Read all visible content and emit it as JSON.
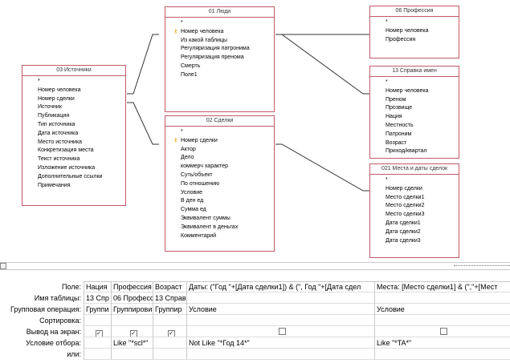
{
  "tables": [
    {
      "id": "t01",
      "title": "01 Люди",
      "fields": [
        {
          "label": "*"
        },
        {
          "label": "Номер человека",
          "key": true
        },
        {
          "label": "Из какой таблицы"
        },
        {
          "label": "Регуляризация патронима"
        },
        {
          "label": "Регуляризация пренома"
        },
        {
          "label": "Смерть"
        },
        {
          "label": "Поле1"
        }
      ]
    },
    {
      "id": "t03",
      "title": "03 Источники",
      "fields": [
        {
          "label": "*"
        },
        {
          "label": "Номер человека"
        },
        {
          "label": "Номер сделки"
        },
        {
          "label": "Источник"
        },
        {
          "label": "Публикация"
        },
        {
          "label": "Тип источника"
        },
        {
          "label": "Дата источника"
        },
        {
          "label": "Место источника"
        },
        {
          "label": "Конкретизация места"
        },
        {
          "label": "Текст источника"
        },
        {
          "label": "Изложение источника"
        },
        {
          "label": "Дополнительные ссылки"
        },
        {
          "label": "Примечания"
        }
      ]
    },
    {
      "id": "t02",
      "title": "02 Сделки",
      "fields": [
        {
          "label": "*"
        },
        {
          "label": "Номер сделки",
          "key": true
        },
        {
          "label": "Актор"
        },
        {
          "label": "Дело"
        },
        {
          "label": "коммерч характер"
        },
        {
          "label": "Суть/объект"
        },
        {
          "label": "По отношению"
        },
        {
          "label": "Условие"
        },
        {
          "label": "В ден ед"
        },
        {
          "label": "Сумма ед"
        },
        {
          "label": "Эквивалент суммы"
        },
        {
          "label": "Эквивалент в деньгах"
        },
        {
          "label": "Комментарий"
        }
      ]
    },
    {
      "id": "t06",
      "title": "06 Профессия",
      "fields": [
        {
          "label": "*"
        },
        {
          "label": "Номер человека"
        },
        {
          "label": "Профессия"
        }
      ]
    },
    {
      "id": "t13",
      "title": "13 Справка имен",
      "fields": [
        {
          "label": "*"
        },
        {
          "label": "Номер человека"
        },
        {
          "label": "Преном"
        },
        {
          "label": "Прозвище"
        },
        {
          "label": "Нация"
        },
        {
          "label": "Местность"
        },
        {
          "label": "Патроним"
        },
        {
          "label": "Возраст"
        },
        {
          "label": "Приход/квартал"
        }
      ]
    },
    {
      "id": "t021",
      "title": "021 Места и даты сделок",
      "fields": [
        {
          "label": "*"
        },
        {
          "label": "Номер сделки"
        },
        {
          "label": "Место сделки1"
        },
        {
          "label": "Место сделки2"
        },
        {
          "label": "Место сделки3"
        },
        {
          "label": "Дата сделки1"
        },
        {
          "label": "Дата сделки2"
        },
        {
          "label": "Дата сделки3"
        }
      ]
    }
  ],
  "grid": {
    "row_labels": [
      "Поле:",
      "Имя таблицы:",
      "Групповая операция:",
      "Сортировка:",
      "Вывод на экран:",
      "Условие отбора:",
      "или:"
    ],
    "columns": [
      {
        "field": "Нация",
        "table": "13 Спр",
        "group": "Группи",
        "sort": "",
        "show": true,
        "criteria": "",
        "or": ""
      },
      {
        "field": "Профессия",
        "table": "06 Професс",
        "group": "Группирови",
        "sort": "",
        "show": true,
        "criteria": "Like \"*scl*\"",
        "or": ""
      },
      {
        "field": "Возраст",
        "table": "13 Справ",
        "group": "Группир",
        "sort": "",
        "show": true,
        "criteria": "",
        "or": ""
      },
      {
        "field": "Даты: (\"Год \"+[Дата сделки1]) & (\", Год \"+[Дата сдел",
        "table": "",
        "group": "Условие",
        "sort": "",
        "show": false,
        "criteria": "Not Like \"*Год 14*\"",
        "or": ""
      },
      {
        "field": "Места: [Место сделки1] & (\",\"+[Мест",
        "table": "",
        "group": "Условие",
        "sort": "",
        "show": false,
        "criteria": "Like \"*TA*\"",
        "or": ""
      }
    ]
  }
}
